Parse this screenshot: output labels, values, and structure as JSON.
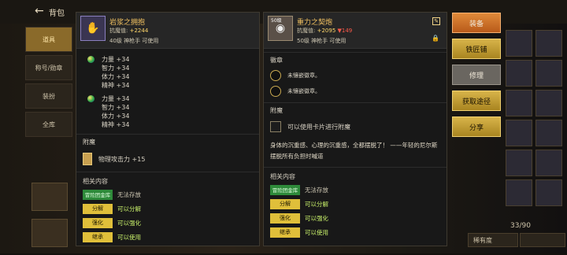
{
  "topbar": {
    "back_label": "背包"
  },
  "leftnav": [
    "道具",
    "称号/勋章",
    "装扮",
    "全库"
  ],
  "inventory": {
    "count": "33/90",
    "sort_label": "稀有度"
  },
  "left_item": {
    "badge": "",
    "name": "岩浆之拥抱",
    "power_label": "抗魔值:",
    "power_value": "+2244",
    "level": "40级 神枪手 可使用",
    "stats_group1": [
      "力量 +34",
      "智力 +34",
      "体力 +34",
      "精神 +34"
    ],
    "stats_group2": [
      "力量 +34",
      "智力 +34",
      "体力 +34",
      "精神 +34"
    ],
    "enchant_title": "附魔",
    "enchant_text": "物理攻击力 +15",
    "related_title": "相关内容",
    "actions": [
      {
        "tag": "冒险团金库",
        "text": "无法存放",
        "style": "green"
      },
      {
        "tag": "分解",
        "text": "可以分解",
        "style": "gold"
      },
      {
        "tag": "强化",
        "text": "可以强化",
        "style": "gold"
      },
      {
        "tag": "继承",
        "text": "可以使用",
        "style": "gold"
      }
    ]
  },
  "right_item": {
    "badge": "50级",
    "name": "重力之契炮",
    "power_label": "抗魔值:",
    "power_value": "+2095",
    "power_diff": "▼149",
    "level": "50级 神枪手 可使用",
    "emblem_title": "徽章",
    "emblem_slots": [
      "未镶嵌徽章。",
      "未镶嵌徽章。"
    ],
    "enchant_title": "附魔",
    "enchant_text": "可以使用卡片进行附魔",
    "description": "身体的沉重感、心理的沉重感，全都摆脱了！ ——年轻的尼尔斯摆脱所有负担时喊道",
    "related_title": "相关内容",
    "actions": [
      {
        "tag": "冒险团金库",
        "text": "无法存放",
        "style": "green"
      },
      {
        "tag": "分解",
        "text": "可以分解",
        "style": "gold"
      },
      {
        "tag": "强化",
        "text": "可以强化",
        "style": "gold"
      },
      {
        "tag": "继承",
        "text": "可以使用",
        "style": "gold"
      }
    ]
  },
  "right_buttons": [
    "装备",
    "铁匠铺",
    "修理",
    "获取途径",
    "分享"
  ]
}
